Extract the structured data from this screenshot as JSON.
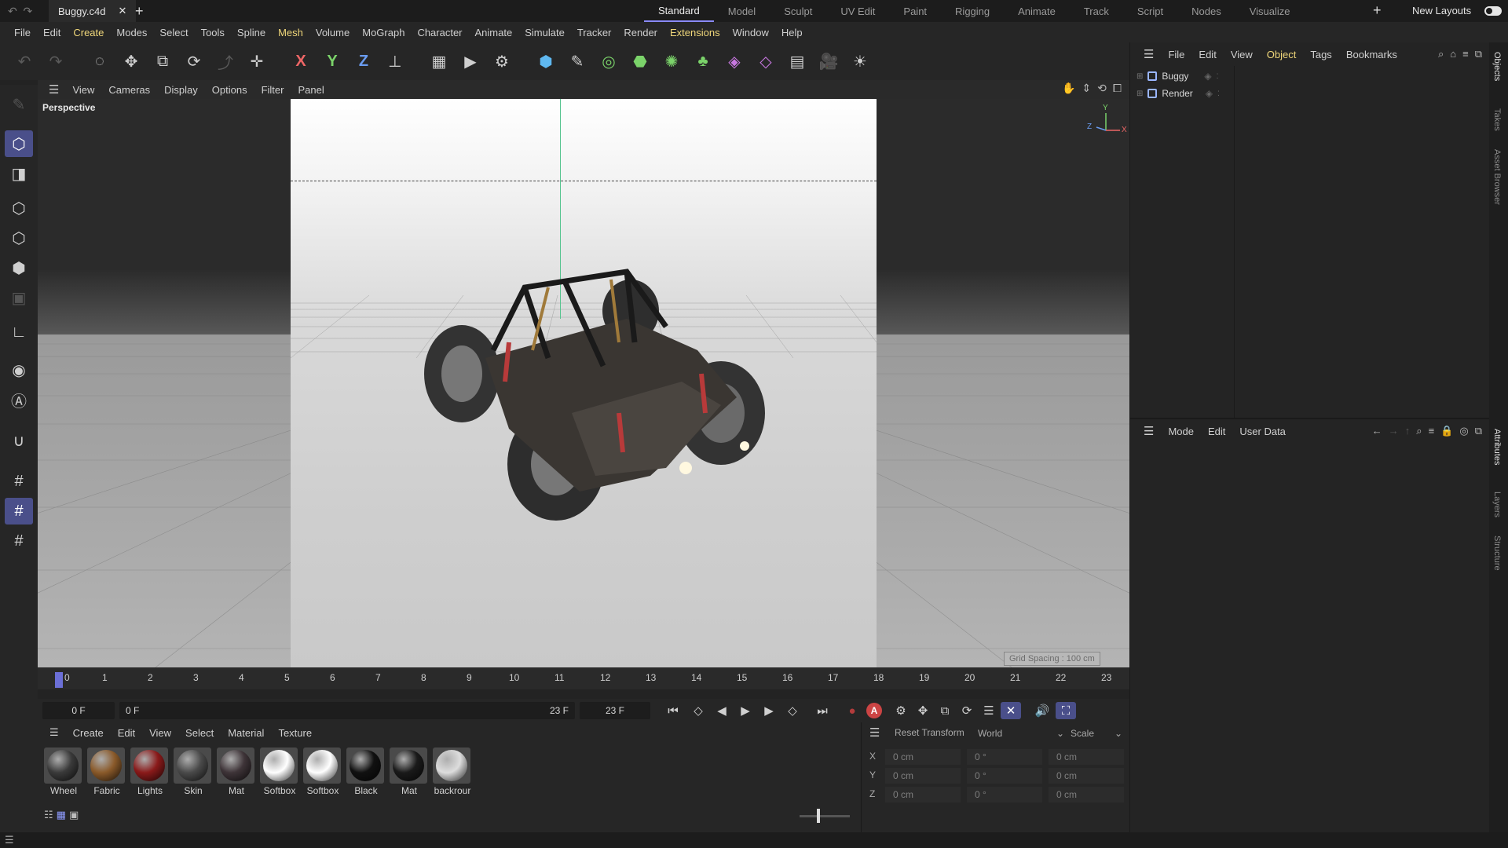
{
  "titlebar": {
    "doc_name": "Buggy.c4d",
    "close": "✕",
    "new_tab": "+",
    "layouts": [
      "Standard",
      "Model",
      "Sculpt",
      "UV Edit",
      "Paint",
      "Rigging",
      "Animate",
      "Track",
      "Script",
      "Nodes",
      "Visualize"
    ],
    "active_layout": "Standard",
    "add_layout": "+",
    "new_layouts": "New Layouts"
  },
  "menubar": [
    "File",
    "Edit",
    "Create",
    "Modes",
    "Select",
    "Tools",
    "Spline",
    "Mesh",
    "Volume",
    "MoGraph",
    "Character",
    "Animate",
    "Simulate",
    "Tracker",
    "Render",
    "Extensions",
    "Window",
    "Help"
  ],
  "viewport": {
    "menu": [
      "View",
      "Cameras",
      "Display",
      "Options",
      "Filter",
      "Panel"
    ],
    "camera_label": "Perspective",
    "grid_spacing": "Grid Spacing : 100 cm",
    "axis_y": "Y",
    "axis_z": "Z",
    "axis_x": "X"
  },
  "timeline": {
    "ticks": [
      "0",
      "1",
      "2",
      "3",
      "4",
      "5",
      "6",
      "7",
      "8",
      "9",
      "10",
      "11",
      "12",
      "13",
      "14",
      "15",
      "16",
      "17",
      "18",
      "19",
      "20",
      "21",
      "22",
      "23"
    ],
    "current_frame": "0 F",
    "range_start": "0 F",
    "range_end": "23 F",
    "end_frame": "23 F",
    "auto_key": "A"
  },
  "materials": {
    "menu": [
      "Create",
      "Edit",
      "View",
      "Select",
      "Material",
      "Texture"
    ],
    "items": [
      {
        "name": "Wheel",
        "color": "#3a3a3a"
      },
      {
        "name": "Fabric",
        "color": "#8a5a2a"
      },
      {
        "name": "Lights",
        "color": "#8a1a1a"
      },
      {
        "name": "Skin",
        "color": "#4a4a4a"
      },
      {
        "name": "Mat",
        "color": "#3e3438"
      },
      {
        "name": "Softbox",
        "color": "#ffffff"
      },
      {
        "name": "Softbox",
        "color": "#ffffff"
      },
      {
        "name": "Black",
        "color": "#111111"
      },
      {
        "name": "Mat",
        "color": "#1a1a1a"
      },
      {
        "name": "backrour",
        "color": "#dddddd"
      }
    ]
  },
  "coordinates": {
    "reset": "Reset Transform",
    "space": "World",
    "mode": "Scale",
    "rows": [
      {
        "axis": "X",
        "pos": "0 cm",
        "rot": "0 °",
        "scale": "0 cm"
      },
      {
        "axis": "Y",
        "pos": "0 cm",
        "rot": "0 °",
        "scale": "0 cm"
      },
      {
        "axis": "Z",
        "pos": "0 cm",
        "rot": "0 °",
        "scale": "0 cm"
      }
    ]
  },
  "objects": {
    "menu": [
      "File",
      "Edit",
      "View",
      "Object",
      "Tags",
      "Bookmarks"
    ],
    "items": [
      "Buggy",
      "Render"
    ]
  },
  "attributes": {
    "menu": [
      "Mode",
      "Edit",
      "User Data"
    ]
  },
  "vtabs": [
    "Objects",
    "Takes",
    "Asset Browser",
    "Attributes",
    "Layers",
    "Structure"
  ]
}
